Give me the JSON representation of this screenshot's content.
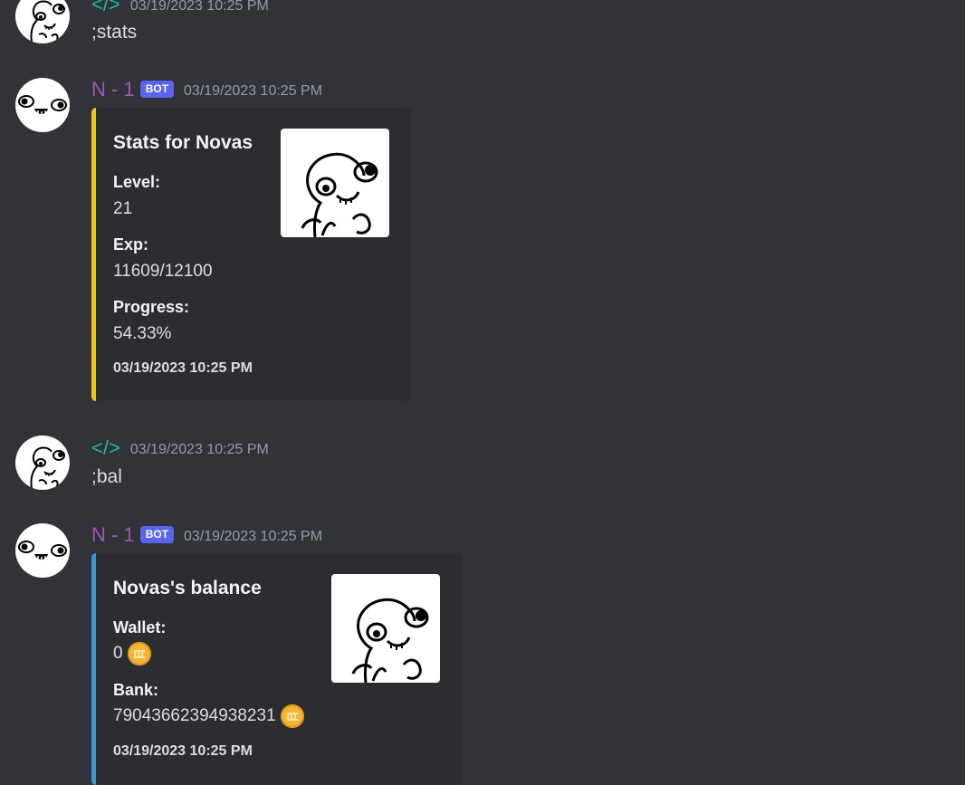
{
  "messages": [
    {
      "author": "</>",
      "timestamp": "03/19/2023 10:25 PM",
      "content": ";stats"
    },
    {
      "author": "N - 1",
      "bot_tag": "BOT",
      "timestamp": "03/19/2023 10:25 PM",
      "embed": {
        "accent_color": "#f1c40f",
        "title": "Stats for Novas",
        "fields": [
          {
            "name": "Level:",
            "value": "21"
          },
          {
            "name": "Exp:",
            "value": "11609/12100"
          },
          {
            "name": "Progress:",
            "value": "54.33%"
          }
        ],
        "footer": "03/19/2023 10:25 PM",
        "thumbnail_icon": "meme-face-thumbnail"
      }
    },
    {
      "author": "</>",
      "timestamp": "03/19/2023 10:25 PM",
      "content": ";bal"
    },
    {
      "author": "N - 1",
      "bot_tag": "BOT",
      "timestamp": "03/19/2023 10:25 PM",
      "embed": {
        "accent_color": "#3498db",
        "title": "Novas's balance",
        "fields": [
          {
            "name": "Wallet:",
            "value": "0",
            "icon": "coin-icon"
          },
          {
            "name": "Bank:",
            "value": "79043662394938231",
            "icon": "coin-icon"
          }
        ],
        "footer": "03/19/2023 10:25 PM",
        "thumbnail_icon": "meme-face-thumbnail"
      }
    }
  ],
  "colors": {
    "background": "#313338",
    "embed_background": "#2b2d31",
    "user_name": "#1abc9c",
    "bot_name": "#9b59b6",
    "bot_tag": "#5865f2"
  }
}
